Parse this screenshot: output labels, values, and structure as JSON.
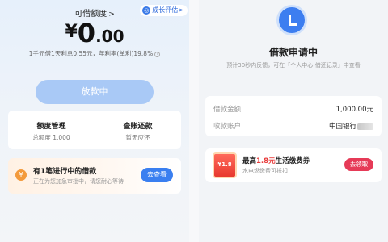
{
  "left": {
    "quota_title": "可借额度",
    "quota_chevron": ">",
    "growth_icon": "◎",
    "growth_label": "成长评估",
    "growth_chevron": ">",
    "currency": "¥",
    "amount_int": "0",
    "amount_dec": ".00",
    "interest_text": "1千元借1天利息0.55元，年利率(单利)19.8%",
    "info_icon": "i",
    "loan_button": "放款中",
    "quota_mgmt_title": "额度管理",
    "quota_mgmt_sub": "总额度 1,000",
    "repay_title": "查账还款",
    "repay_sub": "暂无应还",
    "progress_coin_glyph": "¥",
    "progress_title": "有1笔进行中的借款",
    "progress_sub": "正在为您加急审批中，请您耐心等待",
    "progress_button": "去查看"
  },
  "right": {
    "logo_letter": "L",
    "status_title": "借款申请中",
    "status_sub": "预计30秒内反馈，可在「个人中心-借还记录」中查看",
    "loan_amount_label": "借款金额",
    "loan_amount_value": "1,000.00元",
    "account_label": "收款账户",
    "account_value": "中国银行",
    "coupon_text": "¥1.8",
    "promo_prefix": "最高",
    "promo_highlight": "1.8元",
    "promo_suffix": "生活缴费券",
    "promo_sub": "水电燃缴费可抵扣",
    "claim_button": "去领取"
  },
  "colors": {
    "accent_blue": "#3a7ff0",
    "disabled_blue": "#a9c9f6",
    "promo_red": "#e63a57",
    "coin_orange": "#f39a3c"
  }
}
